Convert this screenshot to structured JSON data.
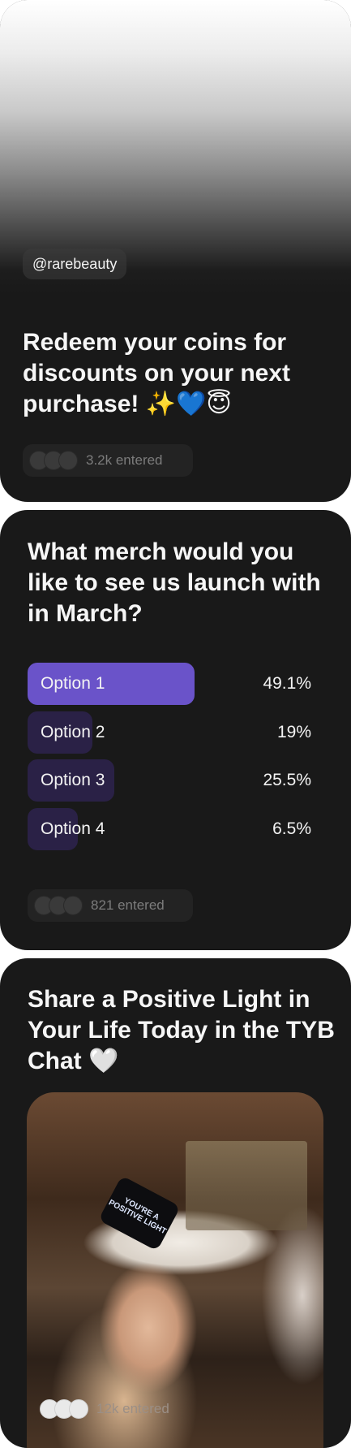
{
  "cards": [
    {
      "handle": "@rarebeauty",
      "title": "Redeem your coins for discounts on your next purchase! ✨💙😇",
      "entered": "3.2k entered"
    },
    {
      "title": "What merch would you like to see us launch with in March?",
      "options": [
        {
          "label": "Option 1",
          "percent": "49.1%",
          "value": 49.1,
          "selected": true
        },
        {
          "label": "Option 2",
          "percent": "19%",
          "value": 19,
          "selected": false
        },
        {
          "label": "Option 3",
          "percent": "25.5%",
          "value": 25.5,
          "selected": false
        },
        {
          "label": "Option 4",
          "percent": "6.5%",
          "value": 6.5,
          "selected": false
        }
      ],
      "entered": "821 entered"
    },
    {
      "title": "Share a Positive Light in Your Life Today in the TYB Chat 🤍",
      "phone_text": "YOU'RE A POSITIVE LIGHT",
      "entered": "12k entered"
    }
  ],
  "colors": {
    "card_bg": "#191919",
    "selected_option": "#6a53c9",
    "unselected_option": "#2a2146"
  }
}
